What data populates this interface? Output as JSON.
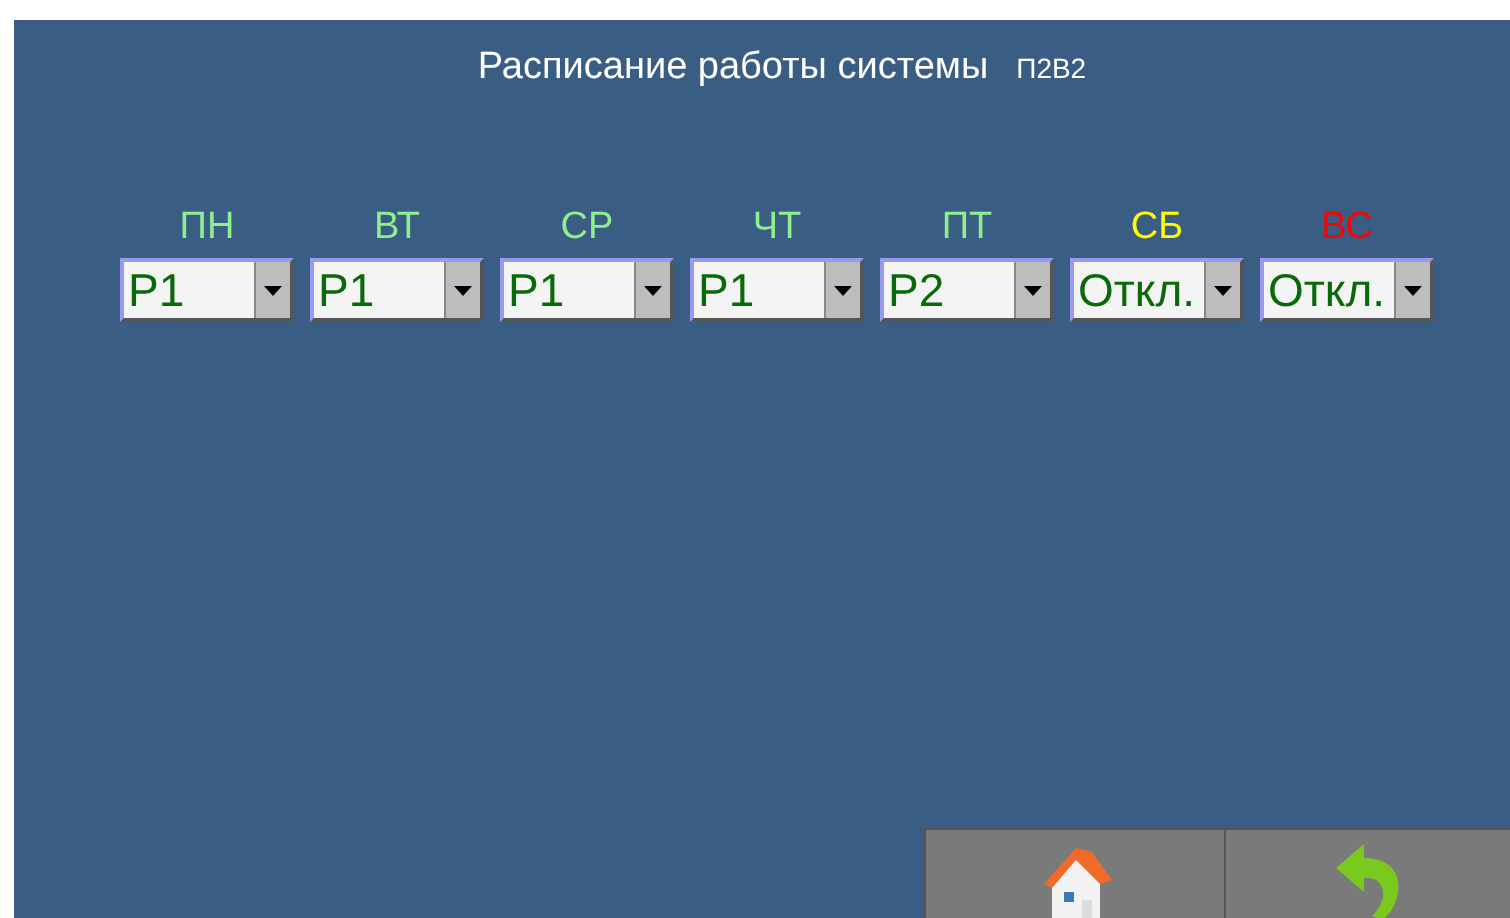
{
  "title": "Расписание работы системы",
  "subtitle": "П2В2",
  "days": [
    {
      "label": "ПН",
      "color": "#90ee90",
      "value": "Р1"
    },
    {
      "label": "ВТ",
      "color": "#90ee90",
      "value": "Р1"
    },
    {
      "label": "СР",
      "color": "#90ee90",
      "value": "Р1"
    },
    {
      "label": "ЧТ",
      "color": "#90ee90",
      "value": "Р1"
    },
    {
      "label": "ПТ",
      "color": "#90ee90",
      "value": "Р2"
    },
    {
      "label": "СБ",
      "color": "#ffff00",
      "value": "Откл."
    },
    {
      "label": "ВС",
      "color": "#ff0000",
      "value": "Откл."
    }
  ],
  "nav_buttons": [
    {
      "kind": "home"
    },
    {
      "kind": "back"
    }
  ]
}
